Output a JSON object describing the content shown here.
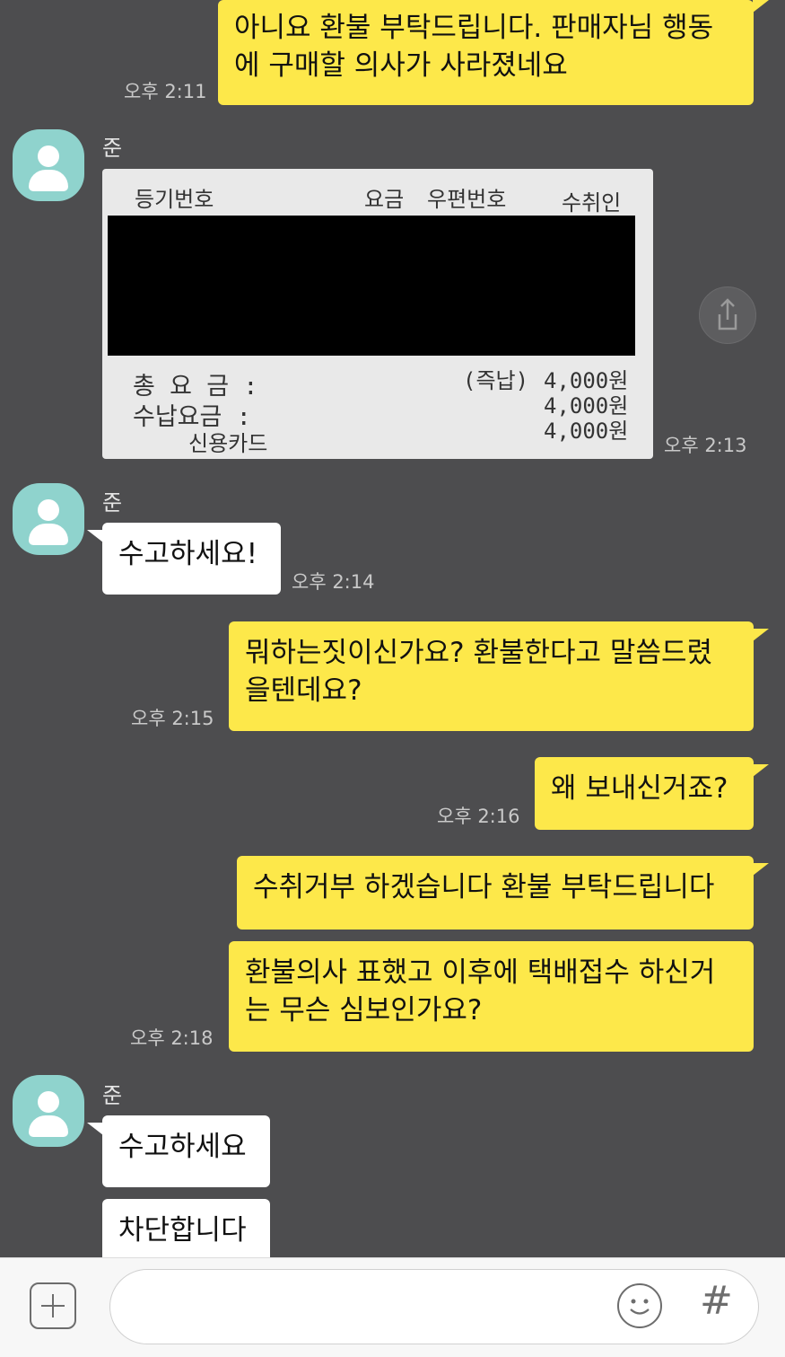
{
  "sender_name": "준",
  "messages": {
    "m1": {
      "text": "아니요 환불 부탁드립니다. 판매자님 행동에 구매할 의사가 사라졌네요",
      "time": "오후 2:11"
    },
    "m2_time": "오후 2:13",
    "m3": {
      "text": "수고하세요!",
      "time": "오후 2:14"
    },
    "m4": {
      "text": "뭐하는짓이신가요? 환불한다고 말씀드렸을텐데요?",
      "time": "오후 2:15"
    },
    "m5": {
      "text": "왜 보내신거죠?",
      "time": "오후 2:16"
    },
    "m6": {
      "text": "수취거부 하겠습니다 환불 부탁드립니다"
    },
    "m7": {
      "text": "환불의사 표했고 이후에 택배접수 하신거는 무슨 심보인가요?",
      "time": "오후 2:18"
    },
    "m8": {
      "text": "수고하세요"
    },
    "m9": {
      "text": "차단합니다"
    }
  },
  "receipt": {
    "col_reg": "등기번호",
    "col_fee": "요금",
    "col_zip": "우편번호",
    "col_recv": "수취인",
    "total_label": "총 요 금 :",
    "paid_label": "수납요금 :",
    "card_label": "신용카드",
    "immediate": "(즉납)",
    "total_value": "4,000원",
    "paid_value": "4,000원",
    "card_value": "4,000원"
  },
  "icons": {
    "share": "share-icon",
    "add": "plus-icon",
    "emoji": "emoji-icon",
    "hash": "hashtag-icon"
  },
  "colors": {
    "background": "#4d4d4f",
    "my_bubble": "#fde84a",
    "other_bubble": "#ffffff",
    "avatar": "#8fd3cd"
  }
}
